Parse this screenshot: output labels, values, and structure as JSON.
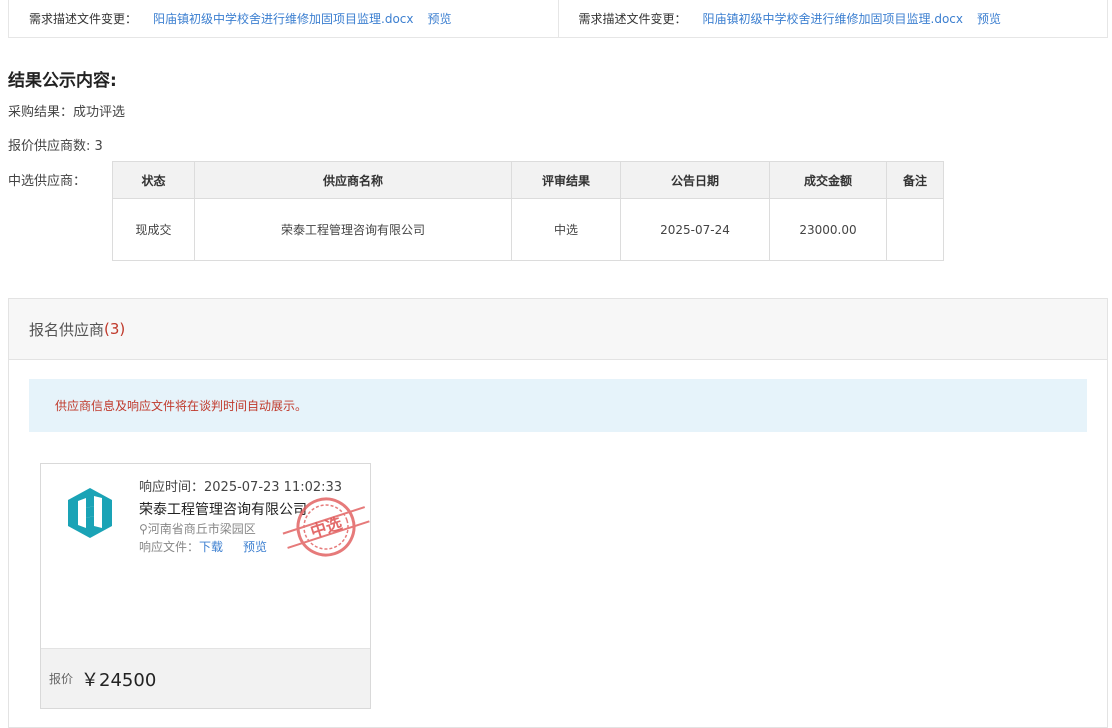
{
  "file_changes": [
    {
      "label": "需求描述文件变更：",
      "file": "阳庙镇初级中学校舍进行维修加固项目监理.docx",
      "preview": "预览"
    },
    {
      "label": "需求描述文件变更：",
      "file": "阳庙镇初级中学校舍进行维修加固项目监理.docx",
      "preview": "预览"
    }
  ],
  "result": {
    "title": "结果公示内容:",
    "procurement_result": "采购结果：成功评选",
    "quote_count": "报价供应商数: 3",
    "selected_label": "中选供应商：",
    "table": {
      "headers": [
        "状态",
        "供应商名称",
        "评审结果",
        "公告日期",
        "成交金额",
        "备注"
      ],
      "rows": [
        [
          "现成交",
          "荣泰工程管理咨询有限公司",
          "中选",
          "2025-07-24",
          "23000.00",
          ""
        ]
      ]
    }
  },
  "suppliers": {
    "title": "报名供应商",
    "count": "(3)",
    "notice": "供应商信息及响应文件将在谈判时间自动展示。",
    "cards": [
      {
        "response_time": "响应时间：2025-07-23 11:02:33",
        "name": "荣泰工程管理咨询有限公司",
        "address": "河南省商丘市梁园区",
        "files_label": "响应文件：",
        "download": "下载",
        "preview": "预览",
        "stamp": "中选",
        "price_label": "报价",
        "price": "￥24500"
      }
    ]
  },
  "colors": {
    "link": "#3c7fd0",
    "accent_red": "#c0392b",
    "logo_teal": "#1aa3b6",
    "stamp_red": "#e05a5a"
  }
}
